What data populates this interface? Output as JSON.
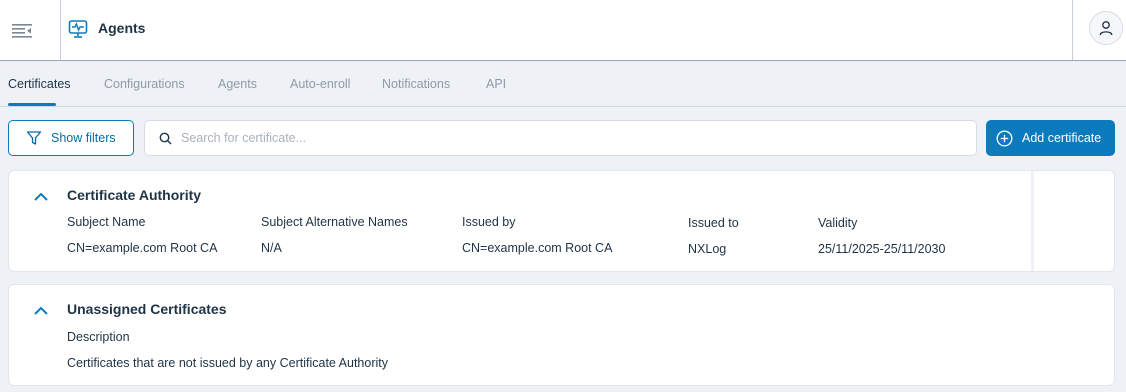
{
  "header": {
    "menu_icon": "menu-collapse-icon",
    "app_icon": "monitor-pulse-icon",
    "title": "Agents",
    "user_icon": "user-icon"
  },
  "tabs": [
    {
      "label": "Certificates",
      "active": true
    },
    {
      "label": "Configurations",
      "active": false
    },
    {
      "label": "Agents",
      "active": false
    },
    {
      "label": "Auto-enroll",
      "active": false
    },
    {
      "label": "Notifications",
      "active": false
    },
    {
      "label": "API",
      "active": false
    }
  ],
  "toolbar": {
    "show_filters_label": "Show filters",
    "search_placeholder": "Search for certificate...",
    "add_label": "Add certificate"
  },
  "cards": [
    {
      "title": "Certificate Authority",
      "columns": [
        "Subject Name",
        "Subject Alternative Names",
        "Issued by",
        "Issued to",
        "Validity"
      ],
      "values": [
        "CN=example.com Root CA",
        "N/A",
        "CN=example.com Root CA",
        "NXLog",
        "25/11/2025-25/11/2030"
      ]
    },
    {
      "title": "Unassigned Certificates",
      "columns": [
        "Description"
      ],
      "values": [
        "Certificates that are not issued by any Certificate Authority"
      ]
    }
  ],
  "colors": {
    "accent": "#0b7bbd",
    "text": "#1f3346",
    "muted": "#8e9aa6",
    "background": "#eef2f7"
  }
}
